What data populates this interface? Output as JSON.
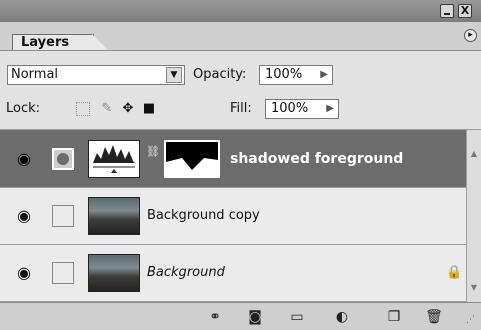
{
  "panel": {
    "tab_label": "Layers",
    "menu_icon": "panel-menu-arrow-icon"
  },
  "window": {
    "close_glyph": "X"
  },
  "options": {
    "blend_mode": "Normal",
    "opacity_label": "Opacity:",
    "opacity_value": "100%",
    "lock_label": "Lock:",
    "fill_label": "Fill:",
    "fill_value": "100%"
  },
  "layers": [
    {
      "name": "shadowed foreground",
      "selected": true,
      "type": "adjustment-with-mask"
    },
    {
      "name": "Background copy",
      "selected": false,
      "type": "image"
    },
    {
      "name": "Background",
      "selected": false,
      "type": "image",
      "locked": true,
      "italic": true
    }
  ],
  "footer": {
    "icons": [
      "link-layers-icon",
      "add-mask-icon",
      "new-group-icon",
      "new-adjustment-layer-icon",
      "new-layer-icon",
      "delete-layer-icon"
    ]
  },
  "colors": {
    "selected_row": "#6c6c6c",
    "panel_bg": "#d4d4d4"
  }
}
